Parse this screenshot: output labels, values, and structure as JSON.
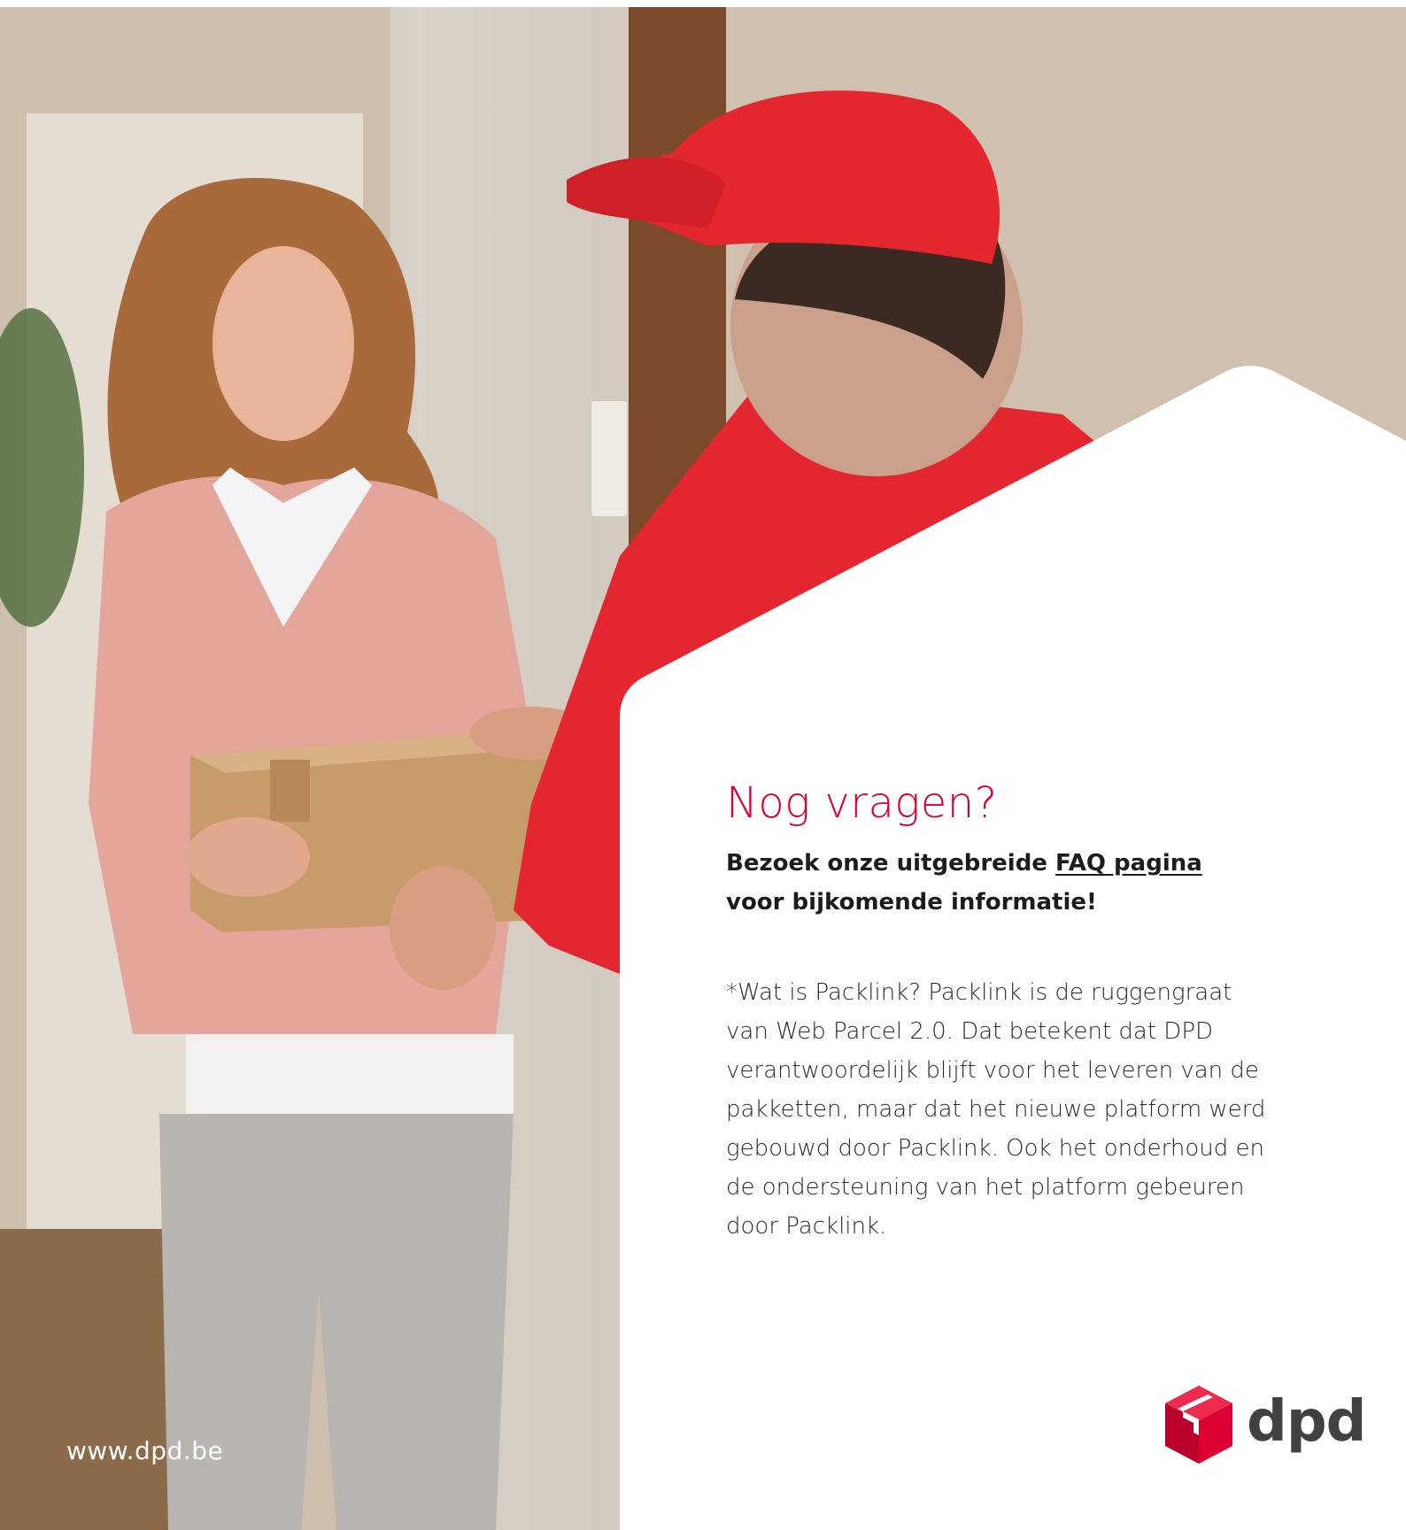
{
  "heading": "Nog vragen?",
  "lead": {
    "before_link": "Bezoek onze uitgebreide ",
    "link_text": "FAQ pagina",
    "after_link": "voor bijkomende informatie!"
  },
  "body_lines": [
    "*Wat is Packlink? Packlink is de ruggengraat",
    "van Web Parcel 2.0. Dat betekent dat DPD",
    "verantwoordelijk blijft voor het leveren van de",
    "pakketten, maar dat het nieuwe platform werd",
    "gebouwd door Packlink. Ook het onderhoud en",
    "de ondersteuning van het platform gebeuren",
    "door Packlink."
  ],
  "footer_url": "www.dpd.be",
  "logo_text": "dpd",
  "colors": {
    "brand_red": "#dc0032",
    "logo_gray": "#414042",
    "text": "#1c1c1c"
  }
}
